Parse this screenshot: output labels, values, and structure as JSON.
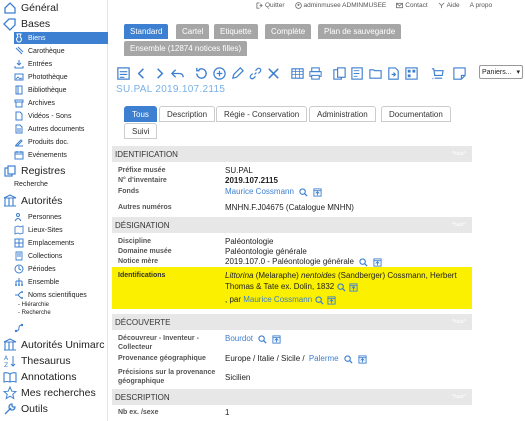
{
  "sidebar": {
    "general": "Général",
    "bases": "Bases",
    "bases_items": [
      "Biens",
      "Carothèque",
      "Entrées",
      "Photothèque",
      "Bibliothèque",
      "Archives",
      "Vidéos - Sons",
      "Autres documents",
      "Produits doc.",
      "Evénements"
    ],
    "registres": "Registres",
    "recherche": "Recherche",
    "autorites": "Autorités",
    "autorites_items": [
      "Personnes",
      "Lieux-Sites",
      "Emplacements",
      "Collections",
      "Périodes",
      "Ensemble",
      "Noms scientifiques"
    ],
    "hierarchie": "- Hiérarchie",
    "recherche_sub": "- Recherche",
    "parcours": "Parcours",
    "autorites_unimarc": "Autorités Unimarc",
    "thesaurus": "Thesaurus",
    "annotations": "Annotations",
    "mes_recherches": "Mes recherches",
    "outils": "Outils"
  },
  "topbar": {
    "quitter": "Quitter",
    "user": "adminmusee ADMINMUSEE",
    "contact": "Contact",
    "aide": "Aide",
    "apropos": "A propo"
  },
  "view_tabs": [
    "Standard",
    "Cartel",
    "Etiquette",
    "Complète",
    "Plan de sauvegarde"
  ],
  "ensemble_tab": "Ensemble (12874 notices filles)",
  "panier_select": "Paniers...",
  "record_id": "SU.PAL 2019.107.2115",
  "record_tabs": [
    "Tous",
    "Description",
    "Régie - Conservation",
    "Administration",
    "Documentation",
    "Suivi"
  ],
  "haut": "^haut^",
  "sections": {
    "identification": {
      "title": "IDENTIFICATION",
      "prefixe_label": "Préfixe musée",
      "prefixe_value": "SU.PAL",
      "inventaire_label": "N° d'inventaire",
      "inventaire_value": "2019.107.2115",
      "fonds_label": "Fonds",
      "fonds_value": "Maurice Cossmann",
      "autres_label": "Autres numéros",
      "autres_value": "MNHN.F.J04675  (Catalogue MNHN)"
    },
    "designation": {
      "title": "DÉSIGNATION",
      "discipline_label": "Discipline",
      "discipline_value": "Paléontologie",
      "domaine_label": "Domaine musée",
      "domaine_value": "Paléontologie générale",
      "mere_label": "Notice mère",
      "mere_value": "2019.107.0 - Paléontologie générale",
      "identif_label": "Identifications",
      "identif_genus": "Littorina",
      "identif_p1": " (Melaraphe) ",
      "identif_species": "nentoides",
      "identif_p2": " (Sandberger) Cossmann, Herbert",
      "identif_line2": "Thomas & Tate ex. Dolin, 1832",
      "identif_line3_pre": ", par ",
      "identif_line3_link": "Maurice Cossmann"
    },
    "decouverte": {
      "title": "DÉCOUVERTE",
      "decouvreur_label": "Découvreur - Inventeur - Collecteur",
      "decouvreur_value": "Bourdot",
      "provenance_label": "Provenance géographique",
      "provenance_value": "Europe / Italie / Sicile / ",
      "provenance_link": "Palerme",
      "precisions_label": "Précisions sur la provenance géographique",
      "precisions_value": "Sicilien"
    },
    "description": {
      "title": "DESCRIPTION",
      "nb_label": "Nb ex. /sexe",
      "nb_value": "1"
    }
  },
  "colors": {
    "accent": "#3d7fd0",
    "highlight": "#faf000",
    "section_bg": "#e7e7e7",
    "tab_inactive": "#a6a6a6"
  }
}
